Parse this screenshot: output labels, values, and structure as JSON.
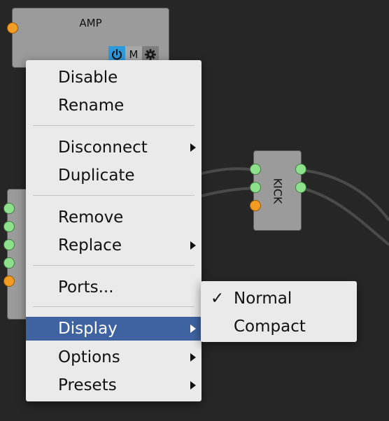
{
  "canvas": {
    "background": "#262626"
  },
  "amp_node": {
    "title": "AMP",
    "mute_label": "M",
    "icons": [
      "power-icon",
      "gear-icon"
    ]
  },
  "kick_node": {
    "title": "KICK"
  },
  "port_colors": {
    "input": "#f39c23",
    "output": "#8fe08c"
  },
  "context_menu": {
    "items": [
      {
        "label": "Disable"
      },
      {
        "label": "Rename"
      },
      {
        "label": "Disconnect",
        "submenu": true
      },
      {
        "label": "Duplicate"
      },
      {
        "label": "Remove"
      },
      {
        "label": "Replace",
        "submenu": true
      },
      {
        "label": "Ports..."
      },
      {
        "label": "Display",
        "submenu": true,
        "highlighted": true
      },
      {
        "label": "Options",
        "submenu": true
      },
      {
        "label": "Presets",
        "submenu": true
      }
    ],
    "highlight_color": "#3f63a0"
  },
  "display_submenu": {
    "check_mark": "✓",
    "items": [
      {
        "label": "Normal",
        "checked": true
      },
      {
        "label": "Compact",
        "checked": false
      }
    ]
  }
}
